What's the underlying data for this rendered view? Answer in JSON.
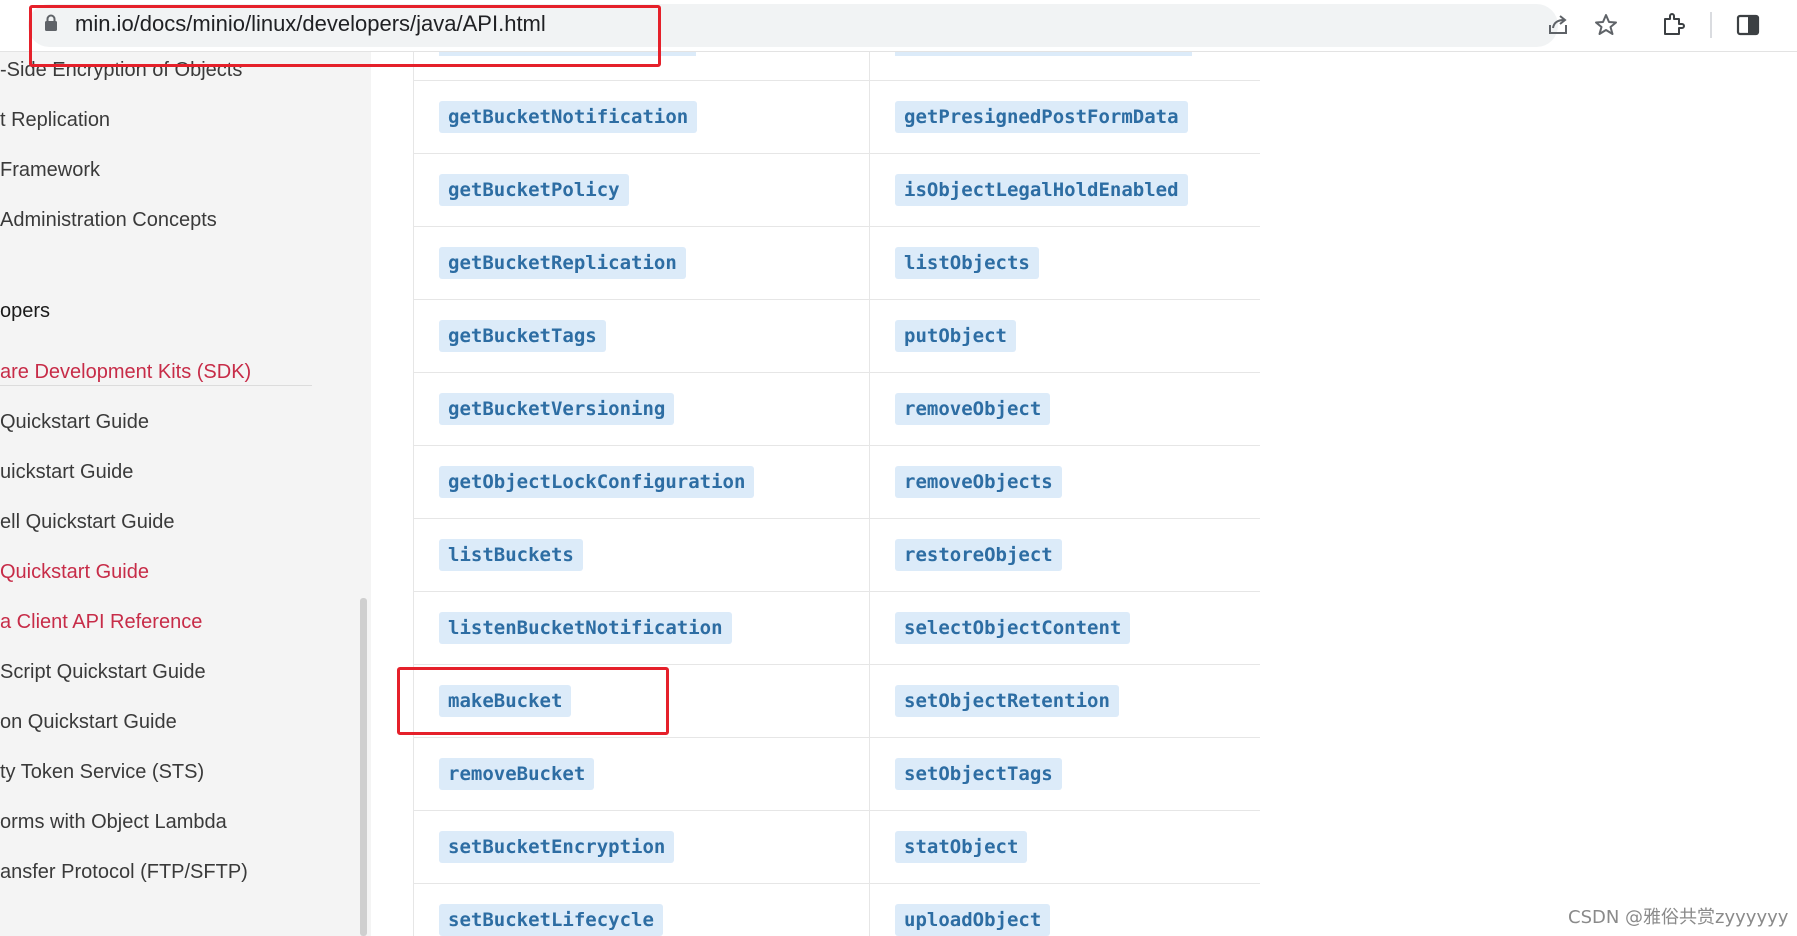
{
  "browser": {
    "url": "min.io/docs/minio/linux/developers/java/API.html"
  },
  "sidebar": {
    "items_top": [
      {
        "label": "-Side Encryption of Objects"
      },
      {
        "label": "t Replication"
      },
      {
        "label": "Framework"
      },
      {
        "label": "Administration Concepts"
      }
    ],
    "section_heading": "opers",
    "items": [
      {
        "label": "are Development Kits (SDK)",
        "active": true
      },
      {
        "label": "Quickstart Guide",
        "active": false
      },
      {
        "label": "uickstart Guide",
        "active": false
      },
      {
        "label": "ell Quickstart Guide",
        "active": false
      },
      {
        "label": "Quickstart Guide",
        "active": true
      },
      {
        "label": "a Client API Reference",
        "active": true
      },
      {
        "label": "Script Quickstart Guide",
        "active": false
      },
      {
        "label": "on Quickstart Guide",
        "active": false
      },
      {
        "label": "ty Token Service (STS)",
        "active": false
      },
      {
        "label": "orms with Object Lambda",
        "active": false
      },
      {
        "label": "ansfer Protocol (FTP/SFTP)",
        "active": false
      }
    ]
  },
  "api_table": {
    "left": [
      "getBucketNotification",
      "getBucketPolicy",
      "getBucketReplication",
      "getBucketTags",
      "getBucketVersioning",
      "getObjectLockConfiguration",
      "listBuckets",
      "listenBucketNotification",
      "makeBucket",
      "removeBucket",
      "setBucketEncryption",
      "setBucketLifecycle"
    ],
    "right": [
      "getPresignedPostFormData",
      "isObjectLegalHoldEnabled",
      "listObjects",
      "putObject",
      "removeObject",
      "removeObjects",
      "restoreObject",
      "selectObjectContent",
      "setObjectRetention",
      "setObjectTags",
      "statObject",
      "uploadObject"
    ]
  },
  "watermark": "CSDN @雅俗共赏zyyyyyy",
  "colors": {
    "chip_bg": "#dcebf9",
    "chip_text": "#2d6da3",
    "sidebar_active": "#c72c48",
    "highlight_box": "#e5202a"
  },
  "icons": [
    "lock-icon",
    "share-icon",
    "star-icon",
    "extensions-icon",
    "side-panel-icon"
  ]
}
